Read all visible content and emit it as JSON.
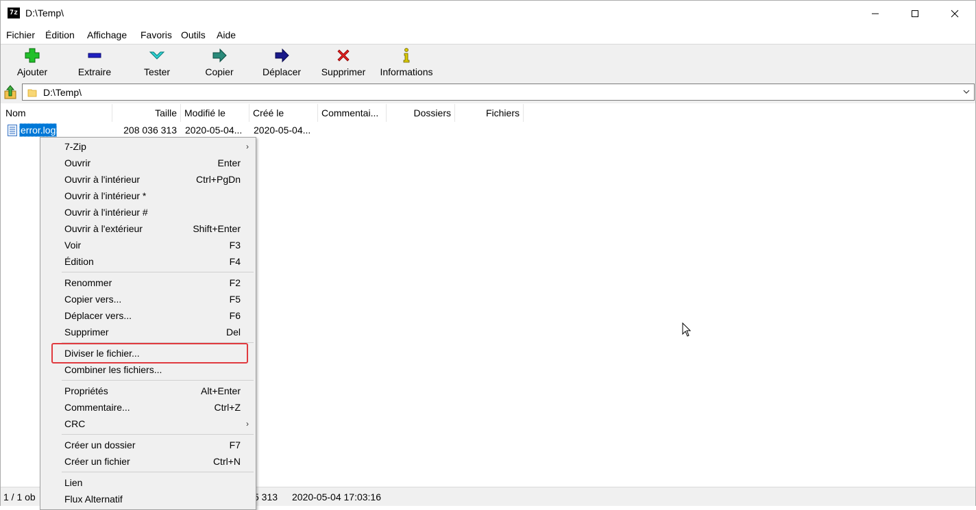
{
  "window": {
    "title": "D:\\Temp\\",
    "app_icon_text": "7z"
  },
  "menubar": [
    "Fichier",
    "Édition",
    "Affichage",
    "Favoris",
    "Outils",
    "Aide"
  ],
  "toolbar": [
    {
      "label": "Ajouter",
      "icon": "plus-icon"
    },
    {
      "label": "Extraire",
      "icon": "minus-icon"
    },
    {
      "label": "Tester",
      "icon": "check-icon"
    },
    {
      "label": "Copier",
      "icon": "copy-arrow-icon"
    },
    {
      "label": "Déplacer",
      "icon": "move-arrow-icon"
    },
    {
      "label": "Supprimer",
      "icon": "delete-x-icon"
    },
    {
      "label": "Informations",
      "icon": "info-icon"
    }
  ],
  "address": {
    "path": "D:\\Temp\\"
  },
  "columns": [
    "Nom",
    "Taille",
    "Modifié le",
    "Créé le",
    "Commentai...",
    "Dossiers",
    "Fichiers"
  ],
  "files": [
    {
      "name": "error.log",
      "size": "208 036 313",
      "modified": "2020-05-04...",
      "created": "2020-05-04..."
    }
  ],
  "status": {
    "selection": "1 / 1 ob",
    "size": "5 313",
    "date": "2020-05-04 17:03:16"
  },
  "context_menu": {
    "items": [
      {
        "label": "7-Zip",
        "shortcut": "",
        "submenu": true
      },
      {
        "label": "Ouvrir",
        "shortcut": "Enter"
      },
      {
        "label": "Ouvrir à l'intérieur",
        "shortcut": "Ctrl+PgDn"
      },
      {
        "label": "Ouvrir à l'intérieur *",
        "shortcut": ""
      },
      {
        "label": "Ouvrir à l'intérieur #",
        "shortcut": ""
      },
      {
        "label": "Ouvrir à l'extérieur",
        "shortcut": "Shift+Enter"
      },
      {
        "label": "Voir",
        "shortcut": "F3"
      },
      {
        "label": "Édition",
        "shortcut": "F4"
      },
      {
        "label": "Renommer",
        "shortcut": "F2"
      },
      {
        "label": "Copier vers...",
        "shortcut": "F5"
      },
      {
        "label": "Déplacer vers...",
        "shortcut": "F6"
      },
      {
        "label": "Supprimer",
        "shortcut": "Del"
      },
      {
        "label": "Diviser le fichier...",
        "shortcut": "",
        "highlighted": true
      },
      {
        "label": "Combiner les fichiers...",
        "shortcut": ""
      },
      {
        "label": "Propriétés",
        "shortcut": "Alt+Enter"
      },
      {
        "label": "Commentaire...",
        "shortcut": "Ctrl+Z"
      },
      {
        "label": "CRC",
        "shortcut": "",
        "submenu": true
      },
      {
        "label": "Créer un dossier",
        "shortcut": "F7"
      },
      {
        "label": "Créer un fichier",
        "shortcut": "Ctrl+N"
      },
      {
        "label": "Lien",
        "shortcut": ""
      },
      {
        "label": "Flux Alternatif",
        "shortcut": ""
      }
    ]
  },
  "colors": {
    "selection": "#0078d7",
    "highlight_border": "#e0393e",
    "toolbar_bg": "#f0f0f0"
  }
}
